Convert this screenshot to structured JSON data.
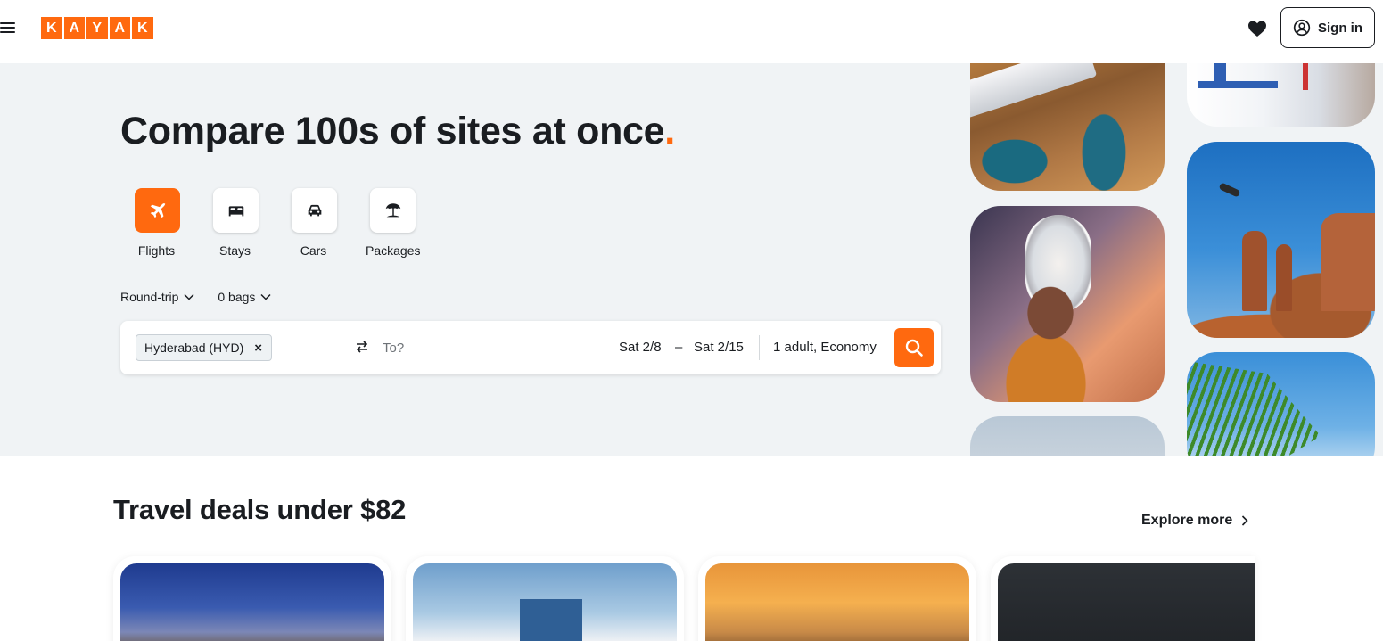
{
  "header": {
    "logo_letters": [
      "K",
      "A",
      "Y",
      "A",
      "K"
    ],
    "signin_label": "Sign in",
    "brand_color": "#ff690f"
  },
  "hero": {
    "title": "Compare 100s of sites at once",
    "title_dot": ".",
    "verticals": [
      {
        "label": "Flights",
        "icon": "plane-icon",
        "active": true
      },
      {
        "label": "Stays",
        "icon": "bed-icon",
        "active": false
      },
      {
        "label": "Cars",
        "icon": "car-icon",
        "active": false
      },
      {
        "label": "Packages",
        "icon": "beach-umbrella-icon",
        "active": false
      }
    ],
    "trip_type": "Round-trip",
    "bags": "0 bags"
  },
  "search": {
    "origin": "Hyderabad (HYD)",
    "origin_remove": "×",
    "destination_placeholder": "To?",
    "depart_date": "Sat 2/8",
    "date_separator": "–",
    "return_date": "Sat 2/15",
    "travelers": "1 adult, Economy"
  },
  "deals": {
    "title": "Travel deals under $82",
    "explore_label": "Explore more"
  }
}
